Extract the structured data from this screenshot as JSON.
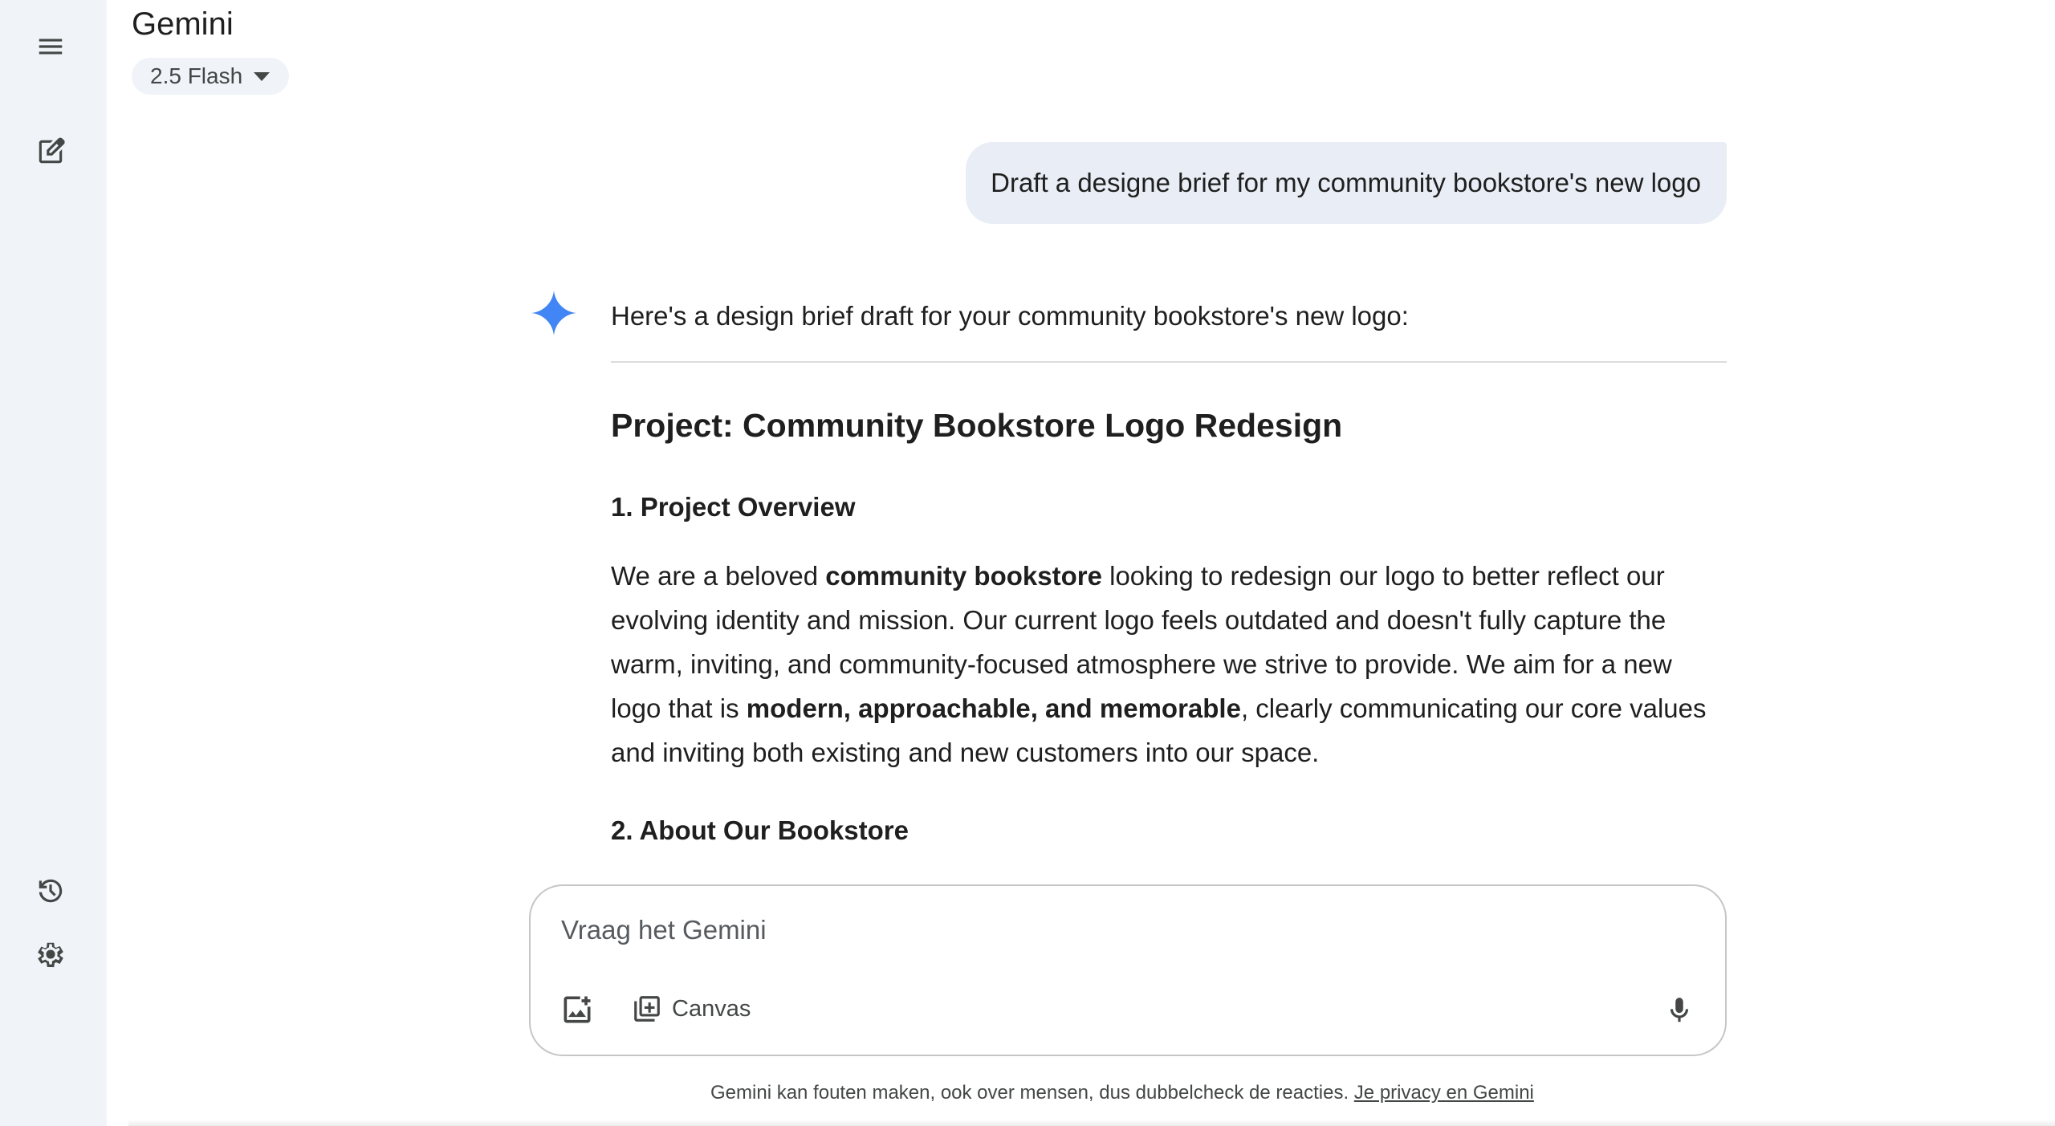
{
  "app": {
    "title": "Gemini",
    "model_label": "2.5 Flash"
  },
  "sidebar": {
    "items": [
      {
        "name": "menu-icon"
      },
      {
        "name": "new-chat-icon"
      },
      {
        "name": "activity-icon"
      },
      {
        "name": "settings-icon"
      }
    ]
  },
  "chat": {
    "user_message": "Draft a designe brief for my community bookstore's new logo",
    "response": {
      "intro": "Here's a design brief draft for your community bookstore's new logo:",
      "heading": "Project: Community Bookstore Logo Redesign",
      "section1_title": "1. Project Overview",
      "section1_p_a": "We are a beloved ",
      "section1_p_b": "community bookstore",
      "section1_p_c": " looking to redesign our logo to better reflect our evolving identity and mission. Our current logo feels outdated and doesn't fully capture the warm, inviting, and community-focused atmosphere we strive to provide. We aim for a new logo that is ",
      "section1_p_d": "modern, approachable, and memorable",
      "section1_p_e": ", clearly communicating our core values and inviting both existing and new customers into our space.",
      "section2_title": "2. About Our Bookstore"
    }
  },
  "composer": {
    "placeholder": "Vraag het Gemini",
    "canvas_label": "Canvas"
  },
  "footer": {
    "disclaimer": "Gemini kan fouten maken, ook over mensen, dus dubbelcheck de reacties. ",
    "privacy_link": "Je privacy en Gemini"
  },
  "colors": {
    "rail_bg": "#f0f4f9",
    "bubble_bg": "#e9eef6",
    "spark_blue": "#4285f4"
  }
}
